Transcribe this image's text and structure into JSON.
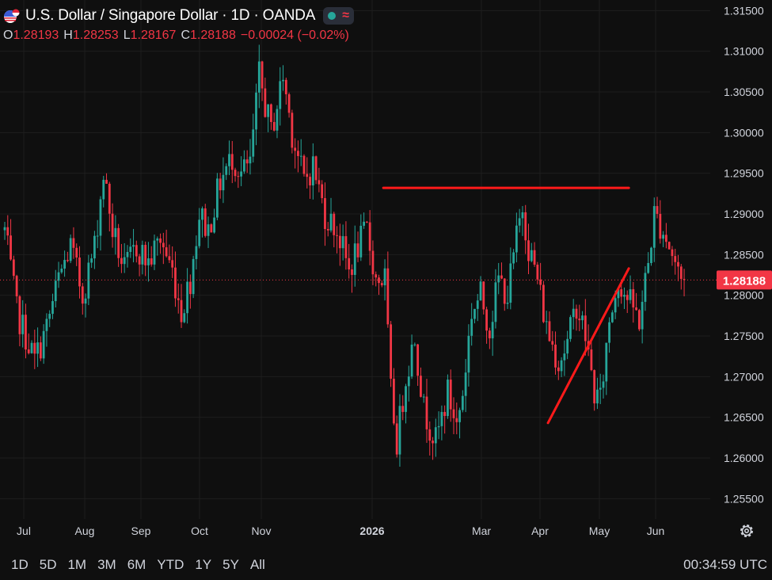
{
  "header": {
    "title": "U.S. Dollar / Singapore Dollar · 1D · OANDA",
    "flag_icon": "us-sg-flag-icon",
    "status_icon": "market-open-dot-icon",
    "wave_icon": "wave-icon",
    "wave_glyph": "≈",
    "ohlc": {
      "o_label": "O",
      "o_value": "1.28193",
      "h_label": "H",
      "h_value": "1.28253",
      "l_label": "L",
      "l_value": "1.28167",
      "c_label": "C",
      "c_value": "1.28188",
      "change": "−0.00024 (−0.02%)"
    }
  },
  "price_axis": {
    "ticks": [
      "1.31500",
      "1.31000",
      "1.30500",
      "1.30000",
      "1.29500",
      "1.29000",
      "1.28500",
      "1.28000",
      "1.27500",
      "1.27000",
      "1.26500",
      "1.26000",
      "1.25500"
    ],
    "current_price_label": "1.28188"
  },
  "time_axis": {
    "labels": [
      {
        "text": "Jul",
        "bold": false
      },
      {
        "text": "Aug",
        "bold": false
      },
      {
        "text": "Sep",
        "bold": false
      },
      {
        "text": "Oct",
        "bold": false
      },
      {
        "text": "Nov",
        "bold": false
      },
      {
        "text": "2026",
        "bold": true
      },
      {
        "text": "Mar",
        "bold": false
      },
      {
        "text": "Apr",
        "bold": false
      },
      {
        "text": "May",
        "bold": false
      },
      {
        "text": "Jun",
        "bold": false
      }
    ]
  },
  "bottom_bar": {
    "ranges": [
      "1D",
      "5D",
      "1M",
      "3M",
      "6M",
      "YTD",
      "1Y",
      "5Y",
      "All"
    ],
    "clock": "00:34:59 UTC"
  },
  "colors": {
    "background": "#0f0f0f",
    "grid": "#1e1e1e",
    "up": "#26a69a",
    "down": "#f23645",
    "trendline": "#ff1a1a",
    "text": "#d1d4dc"
  },
  "chart_data": {
    "type": "candlestick",
    "y_range": [
      1.2525,
      1.3163
    ],
    "current_price": 1.28188,
    "anchors": [
      [
        0,
        1.288
      ],
      [
        4,
        1.278
      ],
      [
        10,
        1.272
      ],
      [
        14,
        1.276
      ],
      [
        18,
        1.282
      ],
      [
        22,
        1.286
      ],
      [
        26,
        1.28
      ],
      [
        30,
        1.286
      ],
      [
        33,
        1.295
      ],
      [
        36,
        1.288
      ],
      [
        40,
        1.283
      ],
      [
        44,
        1.286
      ],
      [
        48,
        1.284
      ],
      [
        52,
        1.287
      ],
      [
        56,
        1.283
      ],
      [
        59,
        1.278
      ],
      [
        62,
        1.282
      ],
      [
        65,
        1.29
      ],
      [
        68,
        1.288
      ],
      [
        72,
        1.294
      ],
      [
        76,
        1.297
      ],
      [
        79,
        1.295
      ],
      [
        82,
        1.296
      ],
      [
        85,
        1.307
      ],
      [
        89,
        1.3
      ],
      [
        93,
        1.307
      ],
      [
        96,
        1.3
      ],
      [
        100,
        1.294
      ],
      [
        103,
        1.296
      ],
      [
        107,
        1.29
      ],
      [
        111,
        1.288
      ],
      [
        115,
        1.283
      ],
      [
        118,
        1.286
      ],
      [
        121,
        1.288
      ],
      [
        124,
        1.282
      ],
      [
        127,
        1.282
      ],
      [
        129,
        1.268
      ],
      [
        131,
        1.262
      ],
      [
        134,
        1.27
      ],
      [
        137,
        1.275
      ],
      [
        140,
        1.266
      ],
      [
        144,
        1.262
      ],
      [
        148,
        1.268
      ],
      [
        151,
        1.264
      ],
      [
        153,
        1.268
      ],
      [
        156,
        1.278
      ],
      [
        159,
        1.28
      ],
      [
        162,
        1.276
      ],
      [
        165,
        1.282
      ],
      [
        168,
        1.28
      ],
      [
        171,
        1.287
      ],
      [
        173,
        1.291
      ],
      [
        175,
        1.286
      ],
      [
        178,
        1.282
      ],
      [
        181,
        1.276
      ],
      [
        185,
        1.272
      ],
      [
        188,
        1.274
      ],
      [
        191,
        1.279
      ],
      [
        194,
        1.275
      ],
      [
        197,
        1.268
      ],
      [
        199,
        1.267
      ],
      [
        202,
        1.277
      ],
      [
        205,
        1.282
      ],
      [
        209,
        1.279
      ],
      [
        212,
        1.277
      ],
      [
        215,
        1.284
      ],
      [
        217,
        1.29
      ],
      [
        220,
        1.288
      ],
      [
        223,
        1.285
      ],
      [
        226,
        1.282
      ],
      [
        227,
        1.2819
      ]
    ],
    "n_candles": 228,
    "seed": 7,
    "lines": [
      {
        "name": "resistance-line",
        "from": [
          126.5,
          1.2932
        ],
        "to": [
          208.5,
          1.2932
        ]
      },
      {
        "name": "support-trendline",
        "from": [
          181.5,
          1.2643
        ],
        "to": [
          208.5,
          1.2833
        ]
      }
    ]
  }
}
